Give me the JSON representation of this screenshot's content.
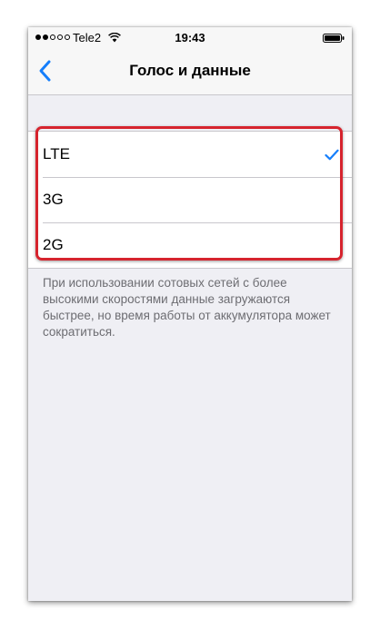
{
  "status_bar": {
    "carrier": "Tele2",
    "time": "19:43",
    "signal_full": 2,
    "signal_total": 5
  },
  "nav": {
    "title": "Голос и данные",
    "back_icon": "chevron-left-icon",
    "accent_color": "#157efb"
  },
  "options": [
    {
      "label": "LTE",
      "selected": true
    },
    {
      "label": "3G",
      "selected": false
    },
    {
      "label": "2G",
      "selected": false
    }
  ],
  "footer_note": "При использовании сотовых сетей с более высокими скоростями данные загружаются быстрее, но время работы от аккумулятора может сократиться.",
  "highlight_color": "#d6242e"
}
